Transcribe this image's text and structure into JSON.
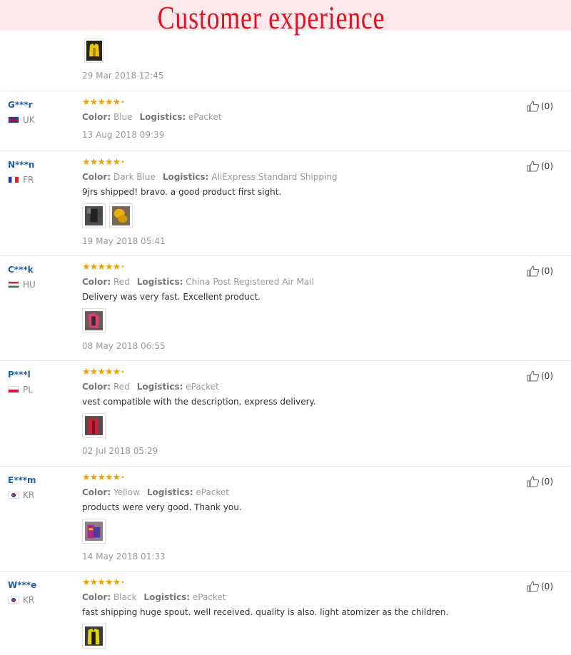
{
  "banner": {
    "title": "Customer experience"
  },
  "lead": {
    "date": "29 Mar 2018 12:45"
  },
  "labels": {
    "color": "Color:",
    "logistics": "Logistics:"
  },
  "reviews": [
    {
      "user": "G***r",
      "country": "UK",
      "color": "Blue",
      "logistics": "ePacket",
      "comment": "",
      "photos": [],
      "date": "13 Aug 2018 09:39",
      "helpful": "(0)"
    },
    {
      "user": "N***n",
      "country": "FR",
      "color": "Dark Blue",
      "logistics": "AliExpress Standard Shipping",
      "comment": "9jrs shipped! bravo. a good product first sight.",
      "photos": [
        "photo-1",
        "photo-2"
      ],
      "date": "19 May 2018 05:41",
      "helpful": "(0)"
    },
    {
      "user": "C***k",
      "country": "HU",
      "color": "Red",
      "logistics": "China Post Registered Air Mail",
      "comment": "Delivery was very fast. Excellent product.",
      "photos": [
        "photo-1"
      ],
      "date": "08 May 2018 06:55",
      "helpful": "(0)"
    },
    {
      "user": "P***l",
      "country": "PL",
      "color": "Red",
      "logistics": "ePacket",
      "comment": "vest compatible with the description, express delivery.",
      "photos": [
        "photo-1"
      ],
      "date": "02 Jul 2018 05:29",
      "helpful": "(0)"
    },
    {
      "user": "E***m",
      "country": "KR",
      "color": "Yellow",
      "logistics": "ePacket",
      "comment": "products were very good. Thank you.",
      "photos": [
        "photo-1"
      ],
      "date": "14 May 2018 01:33",
      "helpful": "(0)"
    },
    {
      "user": "W***e",
      "country": "KR",
      "color": "Black",
      "logistics": "ePacket",
      "comment": "fast shipping huge spout. well received. quality is also. light atomizer as the children.",
      "photos": [
        "photo-1"
      ],
      "date": "",
      "helpful": "(0)"
    }
  ],
  "rating_stars": 5,
  "colors": {
    "star": "#f0a100",
    "username": "#1a5ea8",
    "banner_text": "#e3101f",
    "banner_bg": "#fde8ec"
  }
}
